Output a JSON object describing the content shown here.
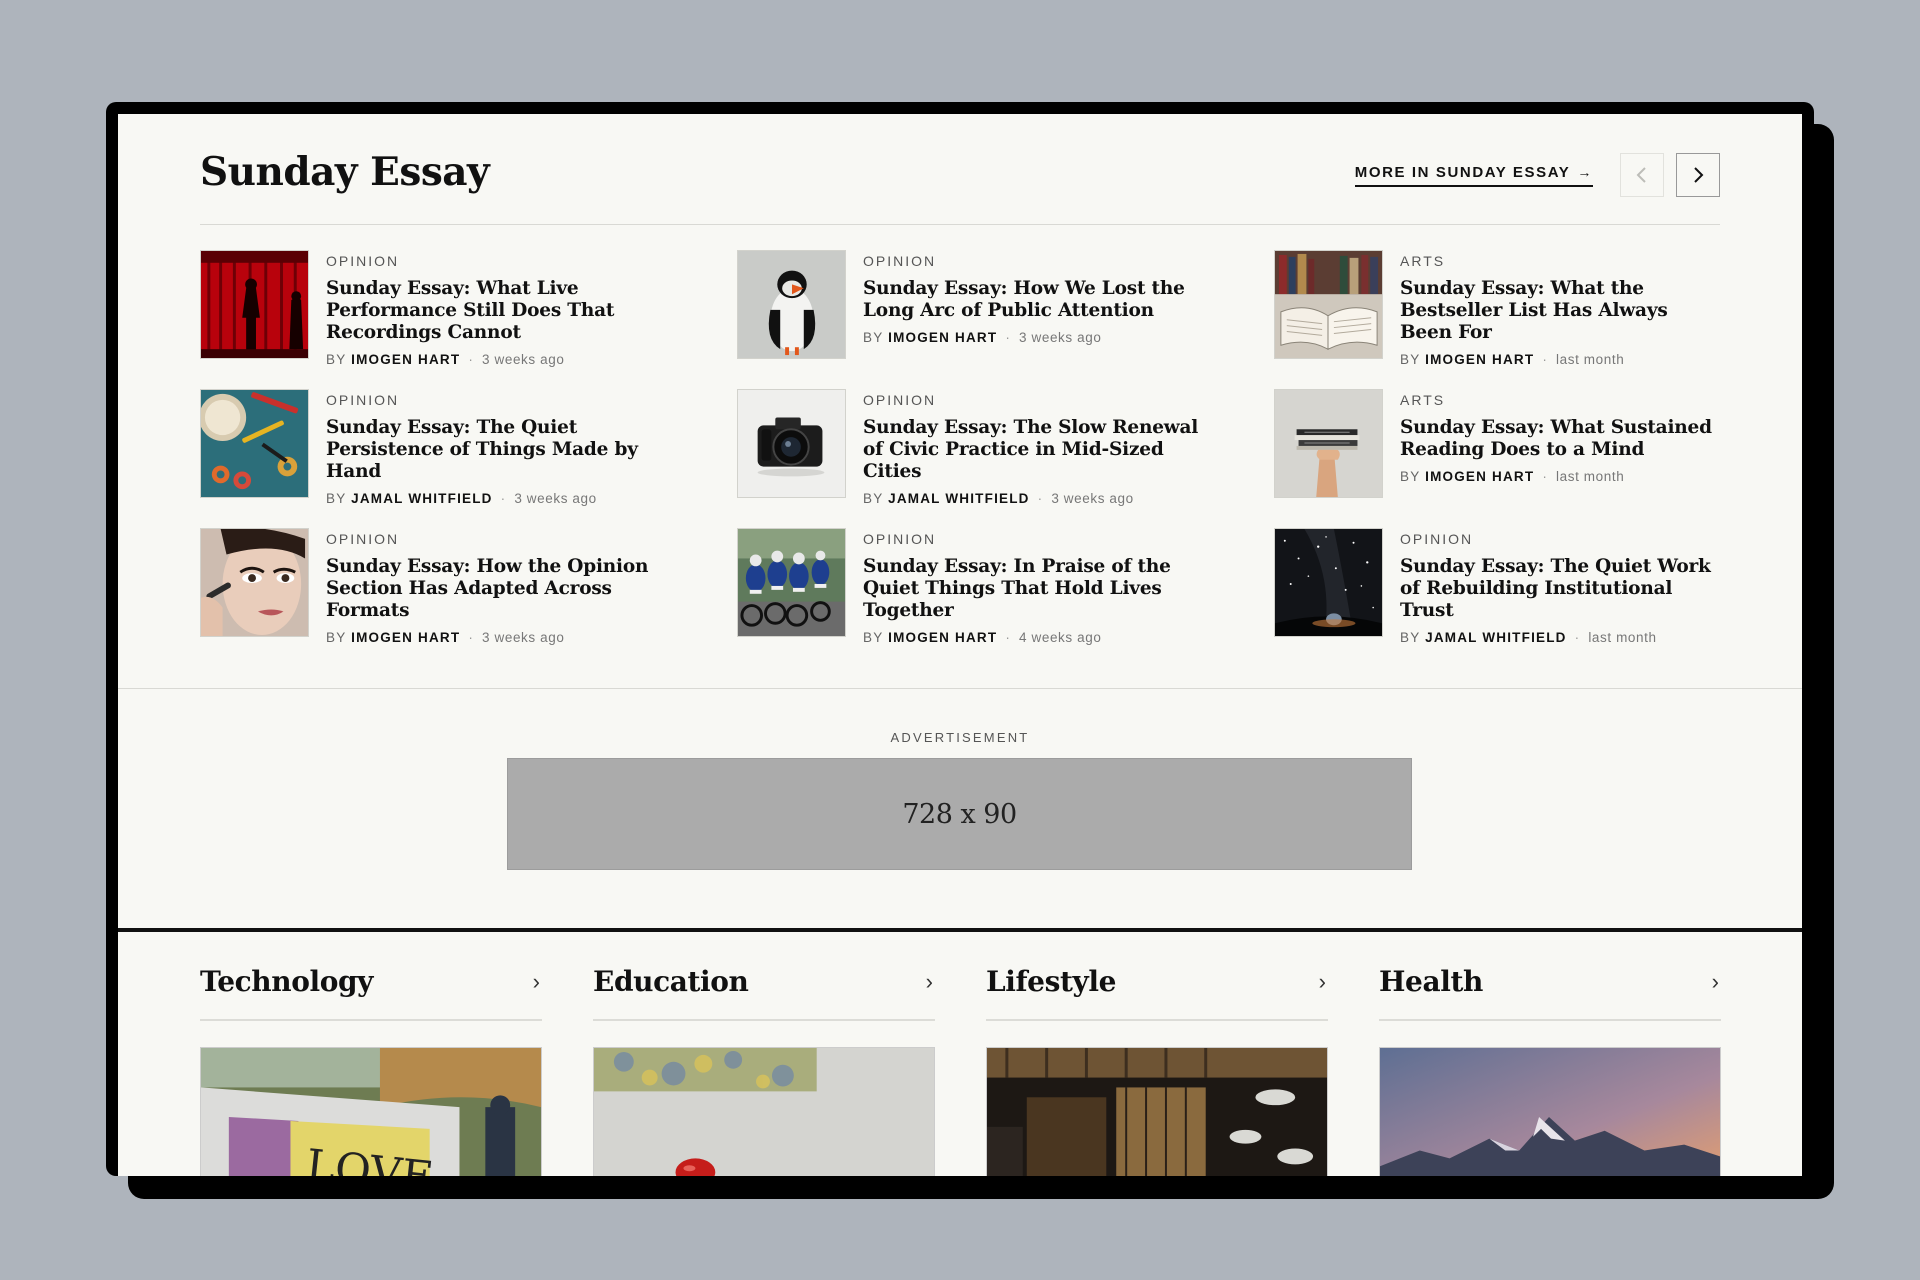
{
  "section": {
    "title": "Sunday Essay",
    "more_label": "MORE IN SUNDAY ESSAY",
    "more_arrow": "→"
  },
  "articles": [
    {
      "kicker": "OPINION",
      "title": "Sunday Essay: What Live Performance Still Does That Recordings Cannot",
      "by": "BY",
      "author": "IMOGEN HART",
      "time": "3 weeks ago",
      "image": "red-curtain-stage-photo"
    },
    {
      "kicker": "OPINION",
      "title": "Sunday Essay: How We Lost the Long Arc of Public Attention",
      "by": "BY",
      "author": "IMOGEN HART",
      "time": "3 weeks ago",
      "image": "puffin-photo"
    },
    {
      "kicker": "ARTS",
      "title": "Sunday Essay: What the Bestseller List Has Always Been For",
      "by": "BY",
      "author": "IMOGEN HART",
      "time": "last month",
      "image": "open-book-photo"
    },
    {
      "kicker": "OPINION",
      "title": "Sunday Essay: The Quiet Persistence of Things Made by Hand",
      "by": "BY",
      "author": "JAMAL WHITFIELD",
      "time": "3 weeks ago",
      "image": "craft-tools-photo"
    },
    {
      "kicker": "OPINION",
      "title": "Sunday Essay: The Slow Renewal of Civic Practice in Mid-Sized Cities",
      "by": "BY",
      "author": "JAMAL WHITFIELD",
      "time": "3 weeks ago",
      "image": "camera-photo"
    },
    {
      "kicker": "ARTS",
      "title": "Sunday Essay: What Sustained Reading Does to a Mind",
      "by": "BY",
      "author": "IMOGEN HART",
      "time": "last month",
      "image": "hand-holding-books-photo"
    },
    {
      "kicker": "OPINION",
      "title": "Sunday Essay: How the Opinion Section Has Adapted Across Formats",
      "by": "BY",
      "author": "IMOGEN HART",
      "time": "3 weeks ago",
      "image": "makeup-portrait-photo"
    },
    {
      "kicker": "OPINION",
      "title": "Sunday Essay: In Praise of the Quiet Things That Hold Lives Together",
      "by": "BY",
      "author": "IMOGEN HART",
      "time": "4 weeks ago",
      "image": "cyclists-photo"
    },
    {
      "kicker": "OPINION",
      "title": "Sunday Essay: The Quiet Work of Rebuilding Institutional Trust",
      "by": "BY",
      "author": "JAMAL WHITFIELD",
      "time": "last month",
      "image": "night-sky-photo"
    }
  ],
  "advertisement": {
    "label": "ADVERTISEMENT",
    "placeholder": "728 x 90"
  },
  "categories": [
    {
      "title": "Technology",
      "chevron": "›",
      "image": "love-sign-photo"
    },
    {
      "title": "Education",
      "chevron": "›",
      "image": "apple-on-desk-photo"
    },
    {
      "title": "Lifestyle",
      "chevron": "›",
      "image": "restaurant-interior-photo"
    },
    {
      "title": "Health",
      "chevron": "›",
      "image": "mountain-sunset-photo"
    }
  ],
  "colors": {
    "page_bg": "#f8f8f4",
    "backdrop": "#aeb4bc",
    "ad_fill": "#ababab",
    "text": "#111111"
  }
}
